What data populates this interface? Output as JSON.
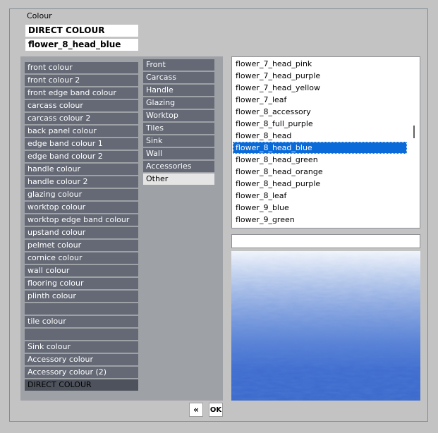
{
  "group_title": "Colour",
  "colour_type_value": "DIRECT COLOUR",
  "colour_name_value": "flower_8_head_blue",
  "left_items": [
    {
      "label": "front colour",
      "state": "normal"
    },
    {
      "label": "front colour 2",
      "state": "normal"
    },
    {
      "label": "front edge band colour",
      "state": "normal"
    },
    {
      "label": "carcass colour",
      "state": "normal"
    },
    {
      "label": "carcass colour 2",
      "state": "normal"
    },
    {
      "label": "back panel colour",
      "state": "normal"
    },
    {
      "label": "edge band colour 1",
      "state": "normal"
    },
    {
      "label": "edge band colour 2",
      "state": "normal"
    },
    {
      "label": "handle colour",
      "state": "normal"
    },
    {
      "label": "handle colour 2",
      "state": "normal"
    },
    {
      "label": "glazing colour",
      "state": "normal"
    },
    {
      "label": "worktop colour",
      "state": "normal"
    },
    {
      "label": "worktop edge band colour",
      "state": "normal"
    },
    {
      "label": "upstand colour",
      "state": "normal"
    },
    {
      "label": "pelmet colour",
      "state": "normal"
    },
    {
      "label": "cornice colour",
      "state": "normal"
    },
    {
      "label": "wall colour",
      "state": "normal"
    },
    {
      "label": "flooring colour",
      "state": "normal"
    },
    {
      "label": "plinth colour",
      "state": "normal"
    },
    {
      "label": "",
      "state": "normal"
    },
    {
      "label": "tile colour",
      "state": "normal"
    },
    {
      "label": "",
      "state": "normal"
    },
    {
      "label": "Sink colour",
      "state": "normal"
    },
    {
      "label": "Accessory colour",
      "state": "normal"
    },
    {
      "label": "Accessory colour (2)",
      "state": "normal"
    },
    {
      "label": "DIRECT COLOUR",
      "state": "selected"
    }
  ],
  "categories": [
    {
      "label": "Front",
      "state": "normal"
    },
    {
      "label": "Carcass",
      "state": "normal"
    },
    {
      "label": "Handle",
      "state": "normal"
    },
    {
      "label": "Glazing",
      "state": "normal"
    },
    {
      "label": "Worktop",
      "state": "normal"
    },
    {
      "label": "Tiles",
      "state": "normal"
    },
    {
      "label": "Sink",
      "state": "normal"
    },
    {
      "label": "Wall",
      "state": "normal"
    },
    {
      "label": "Accessories",
      "state": "normal"
    },
    {
      "label": "Other",
      "state": "selected"
    }
  ],
  "colour_list": [
    {
      "label": "flower_7_head_pink",
      "selected": false
    },
    {
      "label": "flower_7_head_purple",
      "selected": false
    },
    {
      "label": "flower_7_head_yellow",
      "selected": false
    },
    {
      "label": "flower_7_leaf",
      "selected": false
    },
    {
      "label": "flower_8_accessory",
      "selected": false
    },
    {
      "label": "flower_8_full_purple",
      "selected": false
    },
    {
      "label": "flower_8_head",
      "selected": false
    },
    {
      "label": "flower_8_head_blue",
      "selected": true
    },
    {
      "label": "flower_8_head_green",
      "selected": false
    },
    {
      "label": "flower_8_head_orange",
      "selected": false
    },
    {
      "label": "flower_8_head_purple",
      "selected": false
    },
    {
      "label": "flower_8_leaf",
      "selected": false
    },
    {
      "label": "flower_9_blue",
      "selected": false
    },
    {
      "label": "flower_9_green",
      "selected": false
    }
  ],
  "search_value": "",
  "back_button_label": "«",
  "ok_button_label": "OK",
  "colors": {
    "item_bg": "#646975",
    "item_selected_bg": "#4d525c",
    "category_selected_bg": "#e5e5e5",
    "list_selection": "#0a6ad8"
  }
}
